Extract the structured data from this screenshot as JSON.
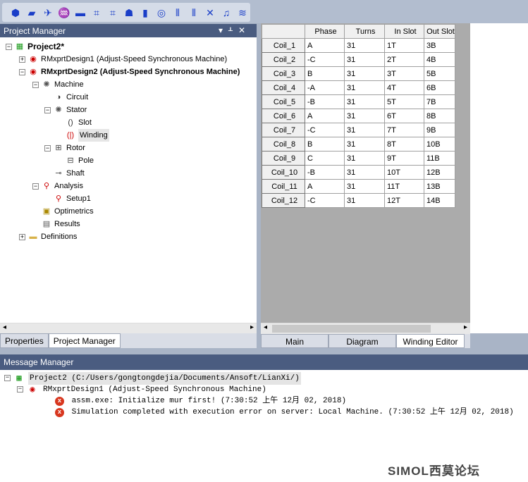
{
  "toolbar": {
    "icons": [
      "geometry-icon",
      "add-material-icon",
      "machine-icon",
      "rmxprt-icon",
      "layers-icon",
      "circuit-add-icon",
      "circuit-list-icon",
      "winding-icon",
      "slot-icon",
      "design-icon",
      "field-icon",
      "field-lines-icon",
      "fold-icon",
      "coil-icon",
      "wave-icon"
    ]
  },
  "project_manager": {
    "title": "Project Manager",
    "tree": [
      {
        "label": "Project2*",
        "level": 0,
        "bold": true,
        "expanded": true,
        "icon": "project-icon"
      },
      {
        "label": "RMxprtDesign1 (Adjust-Speed Synchronous Machine)",
        "level": 1,
        "expanded": false,
        "icon": "design-icon"
      },
      {
        "label": "RMxprtDesign2 (Adjust-Speed Synchronous Machine)",
        "level": 1,
        "bold": true,
        "expanded": true,
        "icon": "design-icon"
      },
      {
        "label": "Machine",
        "level": 2,
        "expanded": true,
        "icon": "machine-icon"
      },
      {
        "label": "Circuit",
        "level": 3,
        "icon": "circuit-icon"
      },
      {
        "label": "Stator",
        "level": 3,
        "expanded": true,
        "icon": "stator-icon"
      },
      {
        "label": "Slot",
        "level": 4,
        "icon": "slot-icon"
      },
      {
        "label": "Winding",
        "level": 4,
        "selected": true,
        "icon": "winding-icon"
      },
      {
        "label": "Rotor",
        "level": 3,
        "expanded": true,
        "icon": "rotor-icon"
      },
      {
        "label": "Pole",
        "level": 4,
        "icon": "pole-icon"
      },
      {
        "label": "Shaft",
        "level": 3,
        "icon": "shaft-icon"
      },
      {
        "label": "Analysis",
        "level": 2,
        "expanded": true,
        "icon": "analysis-icon"
      },
      {
        "label": "Setup1",
        "level": 3,
        "icon": "setup-icon"
      },
      {
        "label": "Optimetrics",
        "level": 2,
        "icon": "optimetrics-icon"
      },
      {
        "label": "Results",
        "level": 2,
        "icon": "results-icon"
      },
      {
        "label": "Definitions",
        "level": 1,
        "expanded": false,
        "icon": "folder-icon"
      }
    ],
    "tabs": [
      "Properties",
      "Project Manager"
    ],
    "active_tab": "Project Manager"
  },
  "winding_table": {
    "columns": [
      "Phase",
      "Turns",
      "In Slot",
      "Out Slot"
    ],
    "rows": [
      [
        "Coil_1",
        "A",
        "31",
        "1T",
        "3B"
      ],
      [
        "Coil_2",
        "-C",
        "31",
        "2T",
        "4B"
      ],
      [
        "Coil_3",
        "B",
        "31",
        "3T",
        "5B"
      ],
      [
        "Coil_4",
        "-A",
        "31",
        "4T",
        "6B"
      ],
      [
        "Coil_5",
        "-B",
        "31",
        "5T",
        "7B"
      ],
      [
        "Coil_6",
        "A",
        "31",
        "6T",
        "8B"
      ],
      [
        "Coil_7",
        "-C",
        "31",
        "7T",
        "9B"
      ],
      [
        "Coil_8",
        "B",
        "31",
        "8T",
        "10B"
      ],
      [
        "Coil_9",
        "C",
        "31",
        "9T",
        "11B"
      ],
      [
        "Coil_10",
        "-B",
        "31",
        "10T",
        "12B"
      ],
      [
        "Coil_11",
        "A",
        "31",
        "11T",
        "13B"
      ],
      [
        "Coil_12",
        "-C",
        "31",
        "12T",
        "14B"
      ]
    ],
    "tabs": [
      "Main",
      "Diagram",
      "Winding Editor"
    ],
    "active_tab": "Winding Editor"
  },
  "message_manager": {
    "title": "Message Manager",
    "project": "Project2 (C:/Users/gongtongdejia/Documents/Ansoft/LianXi/)",
    "design": "RMxprtDesign1 (Adjust-Speed Synchronous Machine)",
    "messages": [
      "assm.exe: Initialize mur first! (7:30:52 上午  12月 02, 2018)",
      "Simulation completed with execution error on server: Local Machine. (7:30:52 上午  12月 02, 2018)"
    ]
  },
  "watermark": "SIMOL西莫论坛"
}
